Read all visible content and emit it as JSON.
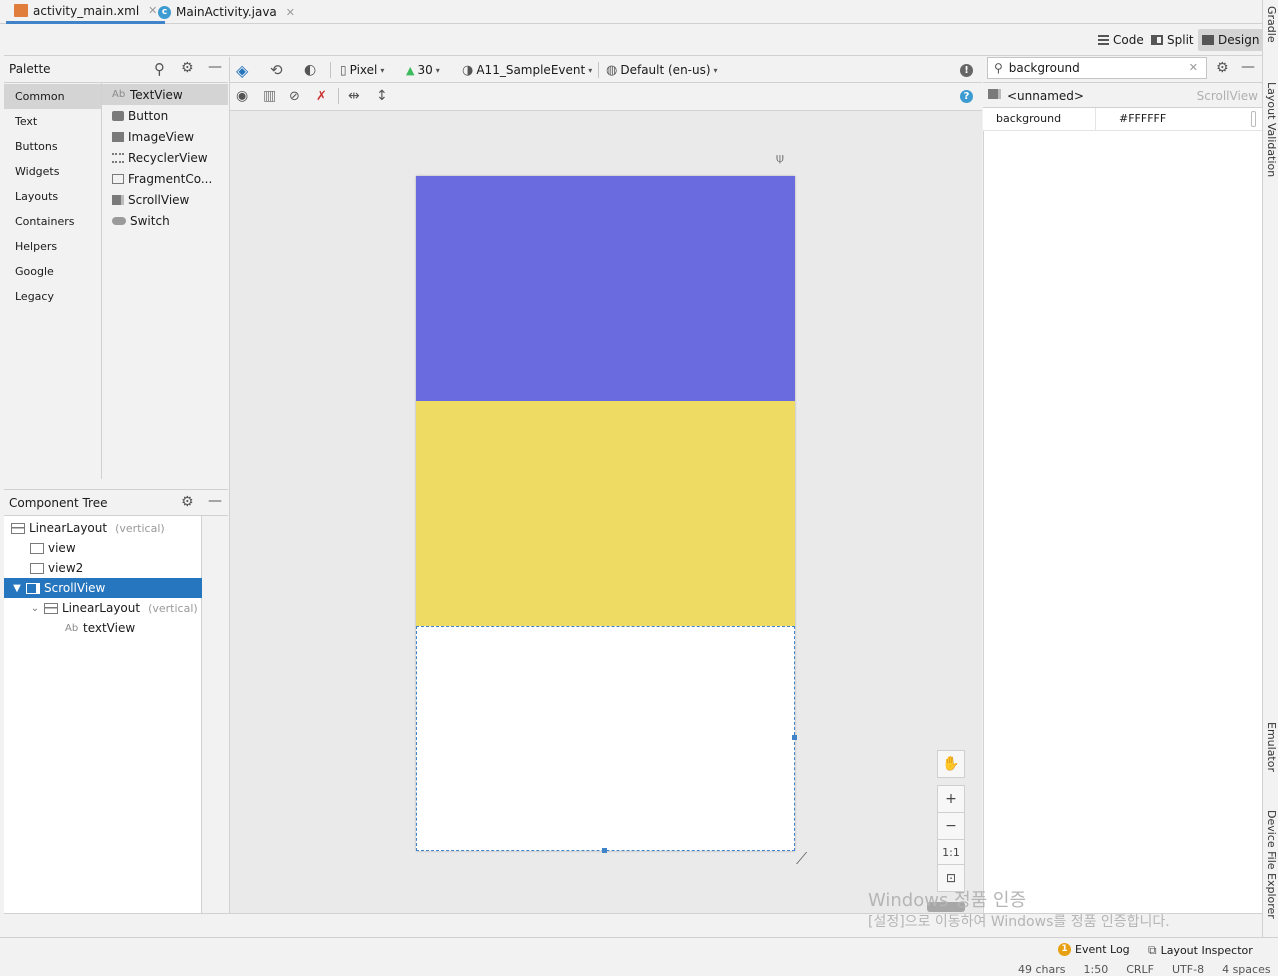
{
  "tabs": [
    {
      "label": "activity_main.xml",
      "active": true
    },
    {
      "label": "MainActivity.java",
      "active": false
    }
  ],
  "view_modes": {
    "code": "Code",
    "split": "Split",
    "design": "Design"
  },
  "right_stripe": {
    "gradle": "Gradle",
    "layout_validation": "Layout Validation",
    "emulator": "Emulator",
    "device_file_explorer": "Device File Explorer"
  },
  "palette": {
    "title": "Palette",
    "categories": [
      "Common",
      "Text",
      "Buttons",
      "Widgets",
      "Layouts",
      "Containers",
      "Helpers",
      "Google",
      "Legacy"
    ],
    "items": [
      "TextView",
      "Button",
      "ImageView",
      "RecyclerView",
      "FragmentCo...",
      "ScrollView",
      "Switch"
    ],
    "textview_prefix": "Ab"
  },
  "design_toolbar": {
    "device": "Pixel",
    "api": "30",
    "theme": "A11_SampleEvent",
    "locale": "Default (en-us)"
  },
  "component_tree": {
    "title": "Component Tree",
    "nodes": [
      {
        "label": "LinearLayout",
        "hint": "(vertical)"
      },
      {
        "label": "view",
        "hint": ""
      },
      {
        "label": "view2",
        "hint": ""
      },
      {
        "label": "ScrollView",
        "hint": ""
      },
      {
        "label": "LinearLayout",
        "hint": "(vertical)"
      },
      {
        "label": "textView",
        "hint": ""
      }
    ],
    "text_prefix": "Ab"
  },
  "canvas": {
    "view_color": "#6A6BDE",
    "view2_color": "#EDDB63",
    "scroll_color": "#FFFFFF",
    "selection_color": "#4083C9"
  },
  "zoom": {
    "in": "+",
    "out": "−",
    "actual": "1:1"
  },
  "attributes": {
    "search_value": "background",
    "component_name": "<unnamed>",
    "component_type": "ScrollView",
    "attr_name": "background",
    "attr_value": "#FFFFFF"
  },
  "status": {
    "event_log_count": "1",
    "event_log": "Event Log",
    "layout_inspector": "Layout Inspector",
    "chars": "49 chars",
    "position": "1:50",
    "line_sep": "CRLF",
    "encoding": "UTF-8",
    "indent": "4 spaces"
  },
  "watermark": {
    "line1": "Windows 정품 인증",
    "line2": "[설정]으로 이동하여 Windows를 정품 인증합니다."
  }
}
